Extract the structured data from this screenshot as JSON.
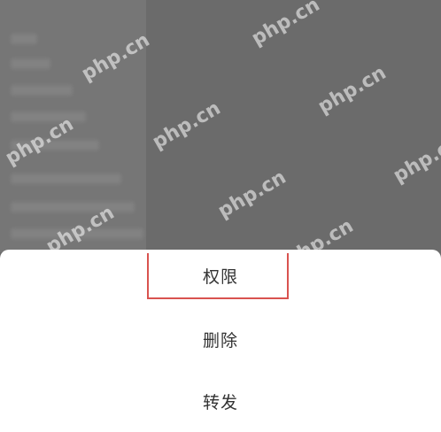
{
  "action_sheet": {
    "items": [
      {
        "label": "权限"
      },
      {
        "label": "删除"
      },
      {
        "label": "转发"
      }
    ]
  },
  "watermark": {
    "text": "php.cn"
  },
  "colors": {
    "overlay": "#6b6b6b",
    "sheet_bg": "#ffffff",
    "highlight_border": "#d9534f",
    "menu_text": "#333333"
  }
}
